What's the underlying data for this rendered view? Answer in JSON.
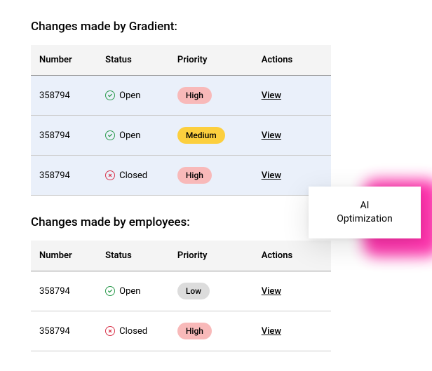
{
  "sections": [
    {
      "title": "Changes made by Gradient:",
      "highlight": true,
      "columns": [
        "Number",
        "Status",
        "Priority",
        "Actions"
      ],
      "rows": [
        {
          "number": "358794",
          "status": "Open",
          "status_kind": "open",
          "priority": "High",
          "priority_kind": "high",
          "action": "View"
        },
        {
          "number": "358794",
          "status": "Open",
          "status_kind": "open",
          "priority": "Medium",
          "priority_kind": "medium",
          "action": "View"
        },
        {
          "number": "358794",
          "status": "Closed",
          "status_kind": "closed",
          "priority": "High",
          "priority_kind": "high",
          "action": "View"
        }
      ]
    },
    {
      "title": "Changes made by employees:",
      "highlight": false,
      "columns": [
        "Number",
        "Status",
        "Priority",
        "Actions"
      ],
      "rows": [
        {
          "number": "358794",
          "status": "Open",
          "status_kind": "open",
          "priority": "Low",
          "priority_kind": "low",
          "action": "View"
        },
        {
          "number": "358794",
          "status": "Closed",
          "status_kind": "closed",
          "priority": "High",
          "priority_kind": "high",
          "action": "View"
        }
      ]
    }
  ],
  "callout": {
    "line1": "AI",
    "line2": "Optimization"
  }
}
